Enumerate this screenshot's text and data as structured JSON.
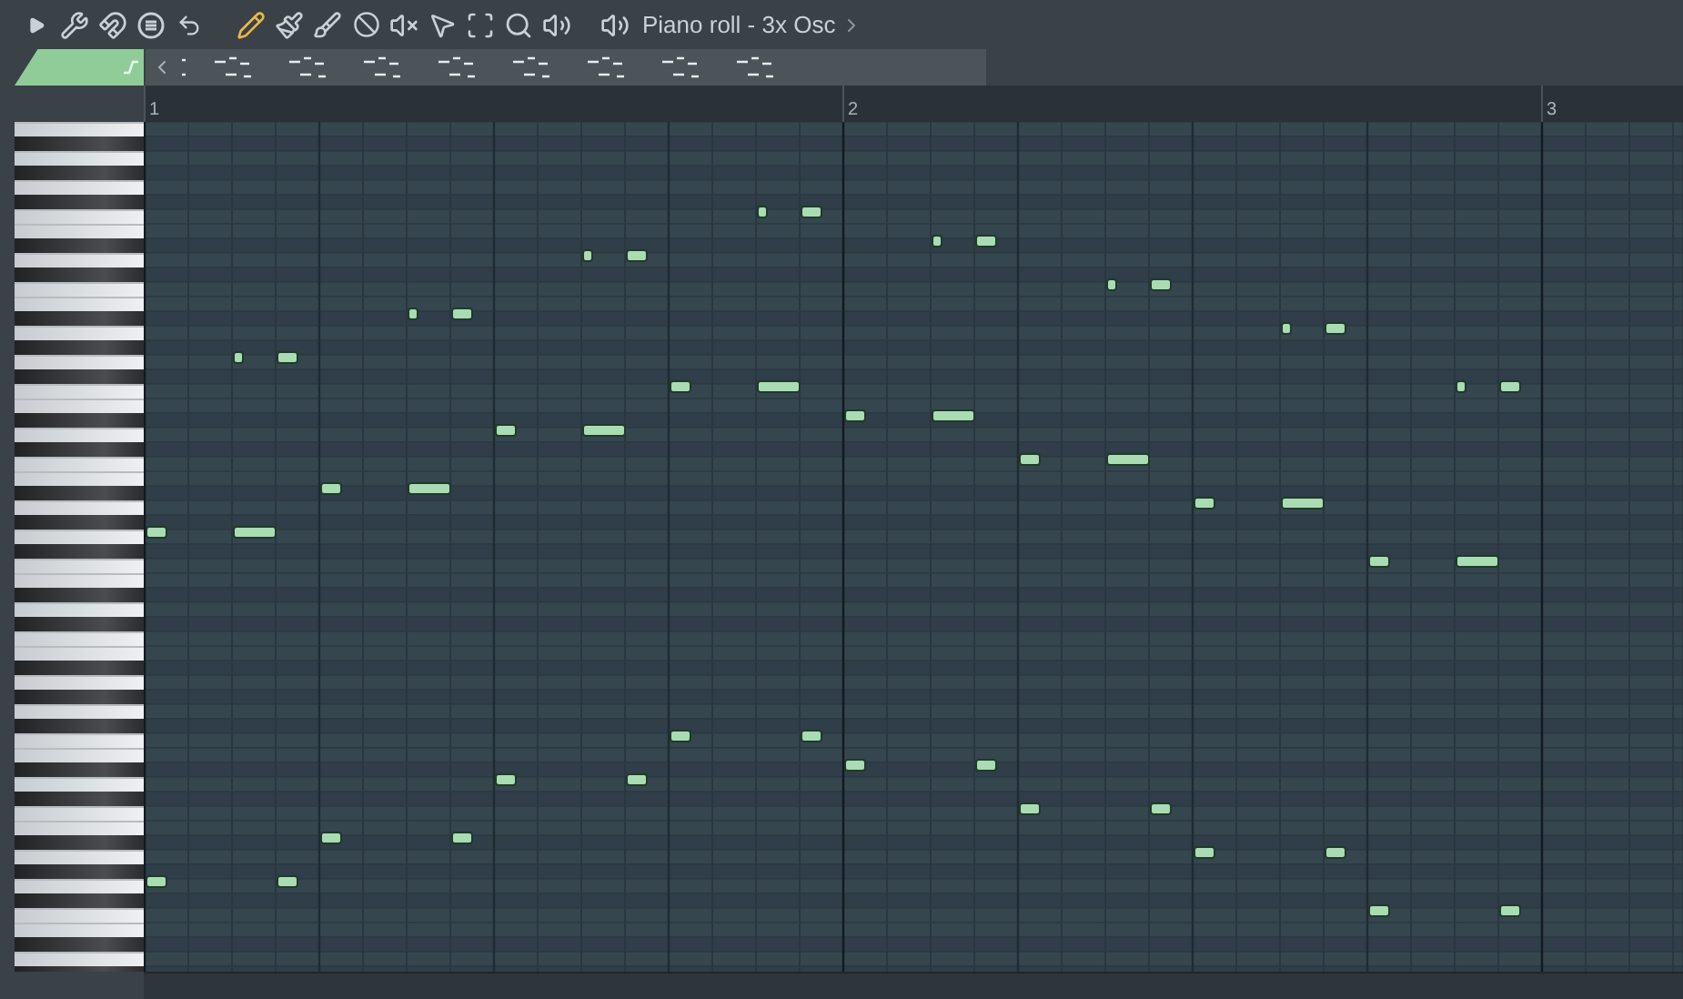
{
  "toolbar": {
    "title": "Piano roll - 3x Osc"
  },
  "ruler": {
    "bars": [
      "1",
      "2",
      "3"
    ]
  }
}
